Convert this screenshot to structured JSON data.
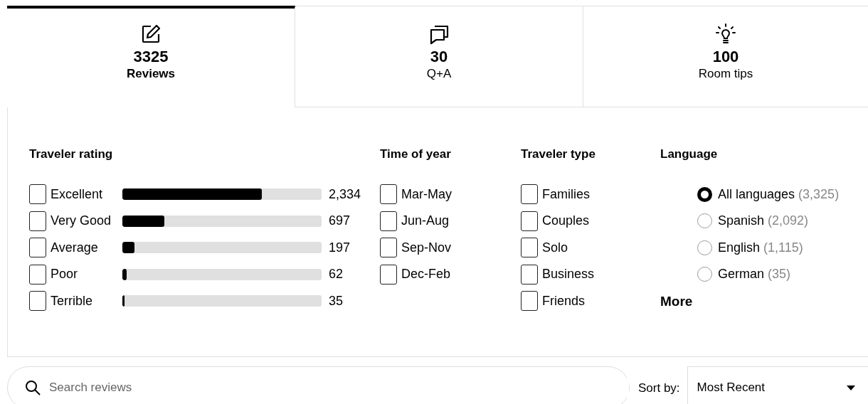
{
  "tabs": [
    {
      "count": "3325",
      "label": "Reviews",
      "kind": "edit",
      "selected": true
    },
    {
      "count": "30",
      "label": "Q+A",
      "kind": "chat",
      "selected": false
    },
    {
      "count": "100",
      "label": "Room tips",
      "kind": "bulb",
      "selected": false
    }
  ],
  "traveler_rating": {
    "title": "Traveler rating",
    "items": [
      {
        "label": "Excellent",
        "checked": false,
        "level": 0.7,
        "count": "2,334"
      },
      {
        "label": "Very Good",
        "checked": false,
        "level": 0.21,
        "count": "697"
      },
      {
        "label": "Average",
        "checked": false,
        "level": 0.06,
        "count": "197"
      },
      {
        "label": "Poor",
        "checked": false,
        "level": 0.02,
        "count": "62"
      },
      {
        "label": "Terrible",
        "checked": false,
        "level": 0.01,
        "count": "35"
      }
    ]
  },
  "time_of_year": {
    "title": "Time of year",
    "items": [
      {
        "label": "Mar-May",
        "checked": false
      },
      {
        "label": "Jun-Aug",
        "checked": false
      },
      {
        "label": "Sep-Nov",
        "checked": false
      },
      {
        "label": "Dec-Feb",
        "checked": false
      }
    ]
  },
  "traveler_type": {
    "title": "Traveler type",
    "items": [
      {
        "label": "Families",
        "checked": false
      },
      {
        "label": "Couples",
        "checked": false
      },
      {
        "label": "Solo",
        "checked": false
      },
      {
        "label": "Business",
        "checked": false
      },
      {
        "label": "Friends",
        "checked": false
      }
    ]
  },
  "language": {
    "title": "Language",
    "items": [
      {
        "label": "All languages",
        "count": "(3,325)",
        "selected": true
      },
      {
        "label": "Spanish",
        "count": "(2,092)",
        "selected": false
      },
      {
        "label": "English",
        "count": "(1,115)",
        "selected": false
      },
      {
        "label": "German",
        "count": "(35)",
        "selected": false
      }
    ],
    "more": "More"
  },
  "search": {
    "placeholder": "Search reviews"
  },
  "sort": {
    "label": "Sort by:",
    "value": "Most Recent"
  }
}
